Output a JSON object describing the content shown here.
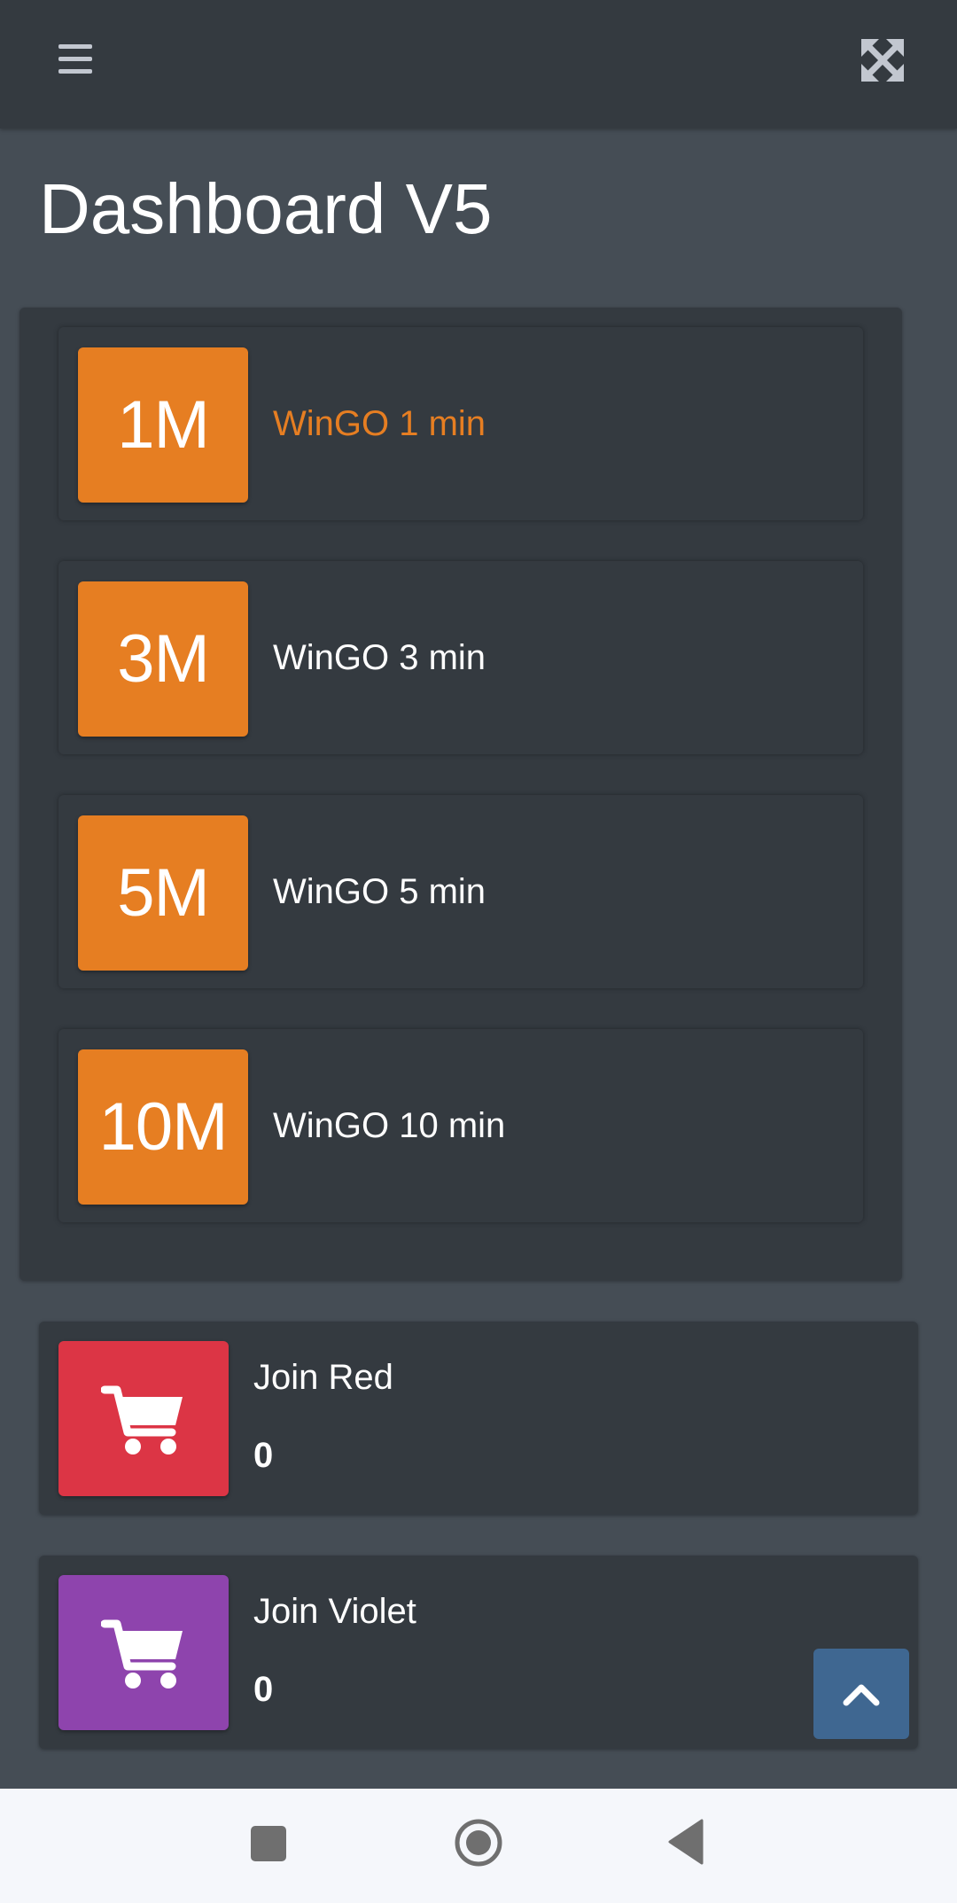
{
  "header": {
    "menu_icon": "hamburger-menu-icon",
    "fullscreen_icon": "expand-arrows-icon"
  },
  "page": {
    "title": "Dashboard V5"
  },
  "games": [
    {
      "badge": "1M",
      "label": "WinGO 1 min",
      "active": true
    },
    {
      "badge": "3M",
      "label": "WinGO 3 min",
      "active": false
    },
    {
      "badge": "5M",
      "label": "WinGO 5 min",
      "active": false
    },
    {
      "badge": "10M",
      "label": "WinGO 10 min",
      "active": false
    }
  ],
  "join_boxes": [
    {
      "label": "Join Red",
      "count": "0",
      "icon": "shopping-cart-icon",
      "color": "#dc3545"
    },
    {
      "label": "Join Violet",
      "count": "0",
      "icon": "shopping-cart-icon",
      "color": "#8e44ad"
    }
  ],
  "colors": {
    "accent_orange": "#e67e22",
    "navbar": "#343a40",
    "background": "#454d55",
    "back_to_top": "#3f6791"
  },
  "icons": {
    "back_to_top": "chevron-up-icon",
    "nav_recents": "square-icon",
    "nav_home": "circle-icon",
    "nav_back": "triangle-back-icon"
  }
}
